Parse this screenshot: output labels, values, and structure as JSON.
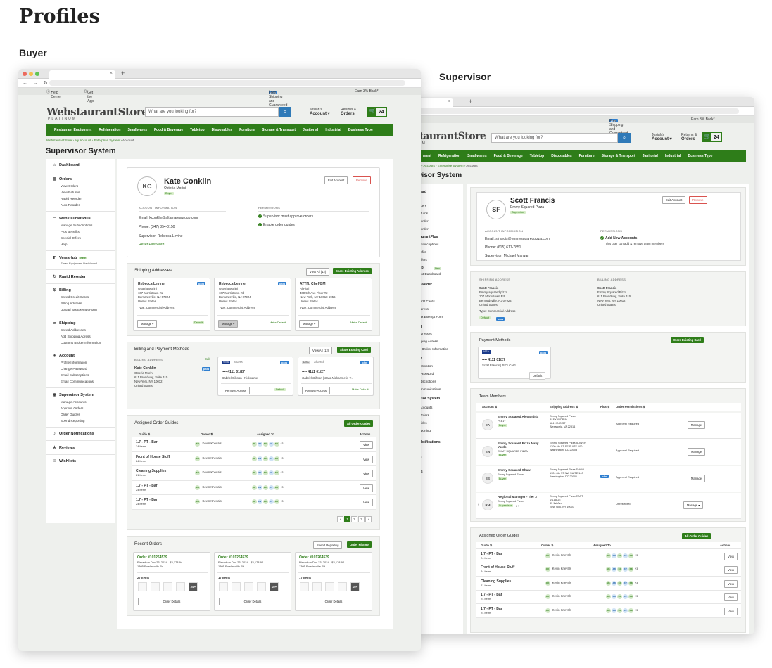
{
  "page_title": "Profiles",
  "labels": {
    "buyer": "Buyer",
    "supervisor": "Supervisor"
  },
  "browser": {
    "plus_tab": "+",
    "tab_close": "×",
    "nav": "← → ↻"
  },
  "site": {
    "help_center": "Help Center",
    "get_app": "Get the App",
    "plus_badge": "plus",
    "free_shipping": "Free Shipping and Guaranteed Savings",
    "earn_back": "Earn 3% Back*",
    "logo": "WebstaurantStore",
    "logo_sup": "staurantStore",
    "logo_sub": "PLATINUM",
    "logo_sub_sup": "UM",
    "search_placeholder": "What are you looking for?",
    "account_greeting_buyer": "Josiah's",
    "account_greeting_sup": "Josiah's",
    "account_label": "Account ▾",
    "returns_label": "Returns &",
    "orders_label": "Orders",
    "cart_count": "24",
    "categories": [
      "Restaurant Equipment",
      "Refrigeration",
      "Smallwares",
      "Food & Beverage",
      "Tabletop",
      "Disposables",
      "Furniture",
      "Storage & Transport",
      "Janitorial",
      "Industrial",
      "Business Type"
    ],
    "sup_categories": [
      "ment",
      "Refrigeration",
      "Smallwares",
      "Food & Beverage",
      "Tabletop",
      "Disposables",
      "Furniture",
      "Storage & Transport",
      "Janitorial",
      "Industrial",
      "Business Type"
    ]
  },
  "buyer": {
    "breadcrumb": [
      "WebstaurantStore",
      "My Account",
      "Enterprise System",
      "Account"
    ],
    "system_title": "Supervisor System",
    "sidebar": {
      "dashboard": "Dashboard",
      "orders": "Orders",
      "orders_items": [
        "View Orders",
        "View Returns",
        "Rapid Reorder",
        "Auto Reorder"
      ],
      "plus": "WebstaurantPlus",
      "plus_items": [
        "Manage Subscriptions",
        "Plus Benefits",
        "Special Offers",
        "Help"
      ],
      "versahub": "VersaHub",
      "versahub_new": "New",
      "versahub_note": "Smart Equipment Dashboard",
      "rapid": "Rapid Reorder",
      "billing": "Billing",
      "billing_items": [
        "Saved Credit Cards",
        "Billing Address",
        "Upload Tax Exempt Form"
      ],
      "shipping": "Shipping",
      "shipping_items": [
        "Saved Addresses",
        "Add Shipping Adress",
        "Customs Broker Information"
      ],
      "account": "Account",
      "account_items": [
        "Profile Information",
        "Change Password",
        "Email Subscriptions",
        "Email Communications"
      ],
      "supervisor": "Supervisor System",
      "supervisor_items": [
        "Manage Accounts",
        "Approve Orders",
        "Order Guides",
        "Spend Reporting"
      ],
      "notifications": "Order Notifications",
      "reviews": "Reviews",
      "wishlists": "Wishlists"
    },
    "profile": {
      "initials": "KC",
      "name": "Kate Conklin",
      "company": "Osteria Morini",
      "role": "Buyer",
      "edit": "Edit Account",
      "remove": "Remove",
      "account_info_label": "ACCOUNT INFORMATION",
      "email": "Email: kconklin@altamareagroup.com",
      "phone": "Phone: (347) 854-0150",
      "supervisor": "Supervisor: Rebecca Levine",
      "reset": "Reset Password",
      "permissions_label": "PERMISSIONS",
      "perms": [
        "Supervisor must approve orders",
        "Enable order guides"
      ]
    },
    "shipping": {
      "title": "Shipping Addresses",
      "view_all": "View All (12)",
      "share": "Share Existing Address",
      "cards": [
        {
          "name": "Rebecca Levine",
          "company": "Osteria Morini",
          "line1": "107 Morristown Rd",
          "line2": "Bernardsville, NJ 07924",
          "country": "United States",
          "type": "Type: Commercial Address",
          "manage": "Manage ▾",
          "right": "Default"
        },
        {
          "name": "Rebecca Levine",
          "company": "Osteria Morini",
          "line1": "107 Morristown Rd",
          "line2": "Bernardsville, NJ 07924",
          "country": "United States",
          "type": "Type: Commercial Address",
          "manage": "Manage ▾",
          "right": "Make Default"
        },
        {
          "name": "ATTN: Chef/GM",
          "company": "Al Fiori",
          "line1": "400 5th Ave Floor #2",
          "line2": "New York, NY 10018-5956",
          "country": "United States",
          "type": "Type: Commercial Address",
          "manage": "Manage ▾",
          "right": "Make Default"
        }
      ]
    },
    "billing": {
      "title": "Billing and Payment Methods",
      "view_all": "View All (12)",
      "share": "Share Existing Card",
      "addr_label": "BILLING ADDRESS",
      "edit": "Edit",
      "name": "Kate Conklin",
      "company": "Osteria Morini",
      "line1": "611 Broadway, Suite 415",
      "line2": "New York, NY 10012",
      "country": "United States",
      "cards": [
        {
          "brand": "VISA",
          "shared": "Shared",
          "num": "•••• 4111  01/27",
          "holder": "Gabriel Gibson | Nickname",
          "left": "Remove Access",
          "right": "Default"
        },
        {
          "brand": "DISC",
          "shared": "Shared",
          "num": "•••• 4111  01/27",
          "holder": "Gabriel Gibson | Card Nickname is T...",
          "left": "Remove Access",
          "right": "Make Default"
        }
      ]
    },
    "guides": {
      "title": "Assigned Order Guides",
      "all": "All Order Guides",
      "cols": [
        "Guide ⇅",
        "Owner ⇅",
        "Assigned To",
        "Actions"
      ],
      "rows": [
        {
          "name": "1.7 - PT - Bar",
          "items": "24 items",
          "owner": "Kevin Knevals",
          "more": "+3",
          "action": "View"
        },
        {
          "name": "Front of House Stuff",
          "items": "24 items",
          "owner": "Kevin Knevals",
          "more": "+3",
          "action": "View"
        },
        {
          "name": "Cleaning Supplies",
          "items": "21 items",
          "owner": "Kevin Knevals",
          "more": "+3",
          "action": "View"
        },
        {
          "name": "1.7 - PT - Bar",
          "items": "24 items",
          "owner": "Kevin Knevals",
          "more": "+3",
          "action": "View"
        },
        {
          "name": "1.7 - PT - Bar",
          "items": "24 items",
          "owner": "Kevin Knevals",
          "more": "+3",
          "action": "View"
        }
      ],
      "owner_initials": "KK",
      "assignees": [
        "JG",
        "JW",
        "KC",
        "KV",
        "KK"
      ],
      "pages": [
        "‹",
        "1",
        "2",
        "3",
        "›"
      ]
    },
    "recent": {
      "title": "Recent Orders",
      "spend": "Spend Reporting",
      "history": "Order History",
      "orders": [
        {
          "num": "Order #101264539",
          "placed": "Placed on Dec 23, 2024 - $3,178.94",
          "addr": "1305 Rowlinsville Rd",
          "count": "27 Items",
          "more": "24+",
          "btn": "Order Details"
        },
        {
          "num": "Order #101264539",
          "placed": "Placed on Dec 23, 2024 - $3,178.94",
          "addr": "1305 Rowlinsville Rd",
          "count": "17 Items",
          "more": "15+",
          "btn": "Order Details"
        },
        {
          "num": "Order #101264539",
          "placed": "Placed on Dec 23, 2024 - $3,178.94",
          "addr": "1305 Rowlinsville Rd",
          "count": "17 Items",
          "more": "15+",
          "btn": "Order Details"
        }
      ]
    }
  },
  "supervisor": {
    "breadcrumb": [
      "WebstaurantStore",
      "My Account",
      "Enterprise System",
      "Account"
    ],
    "system_title": "rvisor System",
    "sidebar": [
      "board",
      "rs",
      "Orders",
      "Returns",
      "Reorder",
      "Reorder",
      "staurantPlus",
      "e Subscriptions",
      "enefits",
      "l Offers",
      "Hub",
      "ment Dashboard",
      "l Reorder",
      "g",
      "Credit Cards",
      "Address",
      "l Tax Exempt Form",
      "ing",
      "Addresses",
      "hipping Adress",
      "ms Broker Information",
      "unt",
      "Information",
      "e Password",
      "Subscriptions",
      "Communications",
      "rvisor System",
      "e Accounts",
      "e Orders",
      "Guides",
      "Reporting",
      "r Notifications",
      "ws",
      "ists"
    ],
    "sidebar_new": "New",
    "profile": {
      "initials": "SF",
      "name": "Scott Francis",
      "company": "Emmy Squared Pizza",
      "role": "Supervisor",
      "edit": "Edit Account",
      "remove": "Remove",
      "account_info_label": "ACCOUNT INFORMATION",
      "email": "Email: sfrancis@emmysquaredpizza.com",
      "phone": "Phone: (615) 617-7851",
      "supervisor": "Supervisor: Michael Marwan",
      "permissions_label": "PERMISSIONS",
      "perm_title": "Add New Accounts",
      "perm_desc": "This user can add & remove team members"
    },
    "shipping": {
      "label": "SHIPPING ADDRESS",
      "name": "Scott Francis",
      "company": "Emmy squared pizza",
      "line1": "107 Morristown Rd",
      "line2": "Bernardsville, NJ 07924",
      "country": "United States",
      "type": "Type: Commercial Address",
      "default": "Default"
    },
    "billing": {
      "label": "BILLING ADDRESS",
      "name": "Scott Francis",
      "company": "Emmy Squared Pizza",
      "line1": "611 Broadway, Suite 415",
      "line2": "New York, NY 10012",
      "country": "United States"
    },
    "payment": {
      "title": "Payment Methods",
      "store": "Store Existing Card",
      "brand": "VISA",
      "num": "•••• 4111  01/27",
      "holder": "Scott Francis | SF's Card",
      "default": "Default"
    },
    "team": {
      "title": "Team Members",
      "cols": [
        "Account ⇅",
        "Shipping Address ⇅",
        "Plus ⇅",
        "Order Permissions ⇅"
      ],
      "rows": [
        {
          "initials": "EA",
          "name": "Emmy Squared Alexandria",
          "sub": "PLE1+",
          "role": "Buyer",
          "addr": [
            "Emmy Squared Pizza",
            "ALEXANDRIA",
            "124 KING ST",
            "Alexandria, VA 22314"
          ],
          "perm": "Approval Required",
          "action": "Manage",
          "plus": ""
        },
        {
          "initials": "EN",
          "name": "Emmy Squared Pizza Navy Yards",
          "sub": "EMMY SQUARED PIZZA",
          "role": "Buyer",
          "addr": [
            "Emmy Squared Pizza BOWER",
            "1300 4th ST SE SUITE 100",
            "Washington, DC 20003"
          ],
          "perm": "Approval Required",
          "action": "Manage",
          "plus": ""
        },
        {
          "initials": "ES",
          "name": "Emmy Squared Shaw",
          "sub": "Emmy Squared Shaw",
          "role": "Buyer",
          "addr": [
            "Emmy Squared Pizza SHAW",
            "1924 8th ST NW SUITE 140",
            "Washington, DC 20001"
          ],
          "perm": "Approval Required",
          "action": "Manage",
          "plus": "plus"
        },
        {
          "initials": "RM",
          "name": "Regional Manager - Tier 3",
          "sub": "Emmy Squared Pizza",
          "role": "Supervisor",
          "extra": "ñ 7",
          "addr": [
            "Emmy Squared Pizza EAST",
            "VILLAGE",
            "83 1st Ave",
            "New York, NY 10003"
          ],
          "perm": "Unrestricted",
          "action": "Manage ▾",
          "plus": ""
        }
      ],
      "expand": "›"
    },
    "guides": {
      "title": "Assigned Order Guides",
      "all": "All Order Guides",
      "cols": [
        "Guide ⇅",
        "Owner ⇅",
        "Assigned To",
        "Actions"
      ],
      "rows": [
        {
          "name": "1.7 - PT - Bar",
          "items": "24 items",
          "owner": "Kevin Knevals",
          "more": "+3",
          "action": "View"
        },
        {
          "name": "Front of House Stuff",
          "items": "24 items",
          "owner": "Kevin Knevals",
          "more": "+3",
          "action": "View"
        },
        {
          "name": "Cleaning Supplies",
          "items": "21 items",
          "owner": "Kevin Knevals",
          "more": "+3",
          "action": "View"
        },
        {
          "name": "1.7 - PT - Bar",
          "items": "24 items",
          "owner": "Kevin Knevals",
          "more": "+3",
          "action": "View"
        },
        {
          "name": "1.7 - PT - Bar",
          "items": "24 items",
          "owner": "Kevin Knevals",
          "more": "+3",
          "action": "View"
        }
      ]
    }
  },
  "colors": {
    "brand_green": "#2e7d19",
    "plus_blue": "#2f7fd0",
    "remove_red": "#d9534f"
  }
}
